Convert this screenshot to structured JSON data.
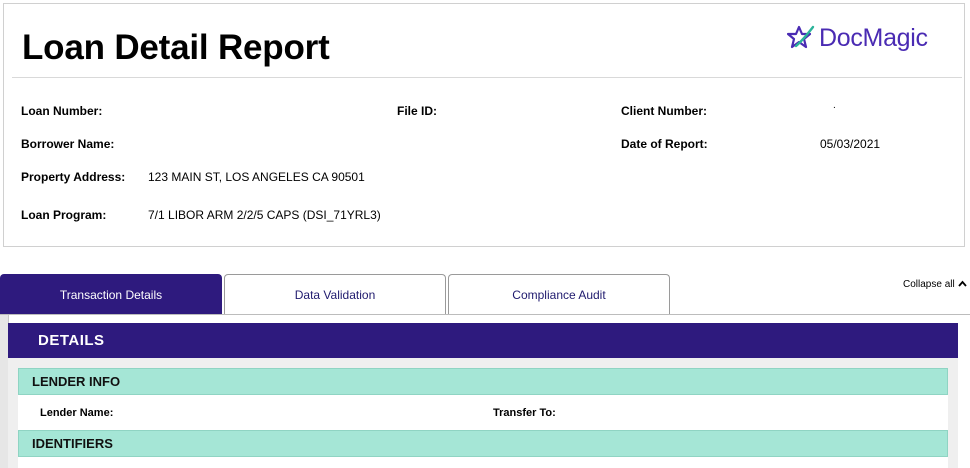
{
  "report": {
    "title": "Loan Detail Report",
    "logo_text": "DocMagic",
    "logo_icon": "star-swoosh-icon",
    "brand_color": "#4a2bb3"
  },
  "fields": {
    "loan_number": {
      "label": "Loan Number:",
      "value": ""
    },
    "file_id": {
      "label": "File ID:",
      "value": ""
    },
    "client_number": {
      "label": "Client Number:",
      "value": "."
    },
    "borrower_name": {
      "label": "Borrower Name:",
      "value": ""
    },
    "date_of_report": {
      "label": "Date of Report:",
      "value": "05/03/2021"
    },
    "property_address": {
      "label": "Property Address:",
      "value": "123 MAIN ST, LOS ANGELES CA 90501"
    },
    "loan_program": {
      "label": "Loan Program:",
      "value": "7/1 LIBOR ARM 2/2/5 CAPS (DSI_71YRL3)"
    }
  },
  "tabs": [
    {
      "label": "Transaction Details",
      "active": true
    },
    {
      "label": "Data Validation",
      "active": false
    },
    {
      "label": "Compliance Audit",
      "active": false
    }
  ],
  "collapse_all": {
    "label": "Collapse all",
    "icon": "chevron-up-icon"
  },
  "details": {
    "heading": "DETAILS",
    "lender_info": {
      "heading": "LENDER INFO",
      "lender_name_label": "Lender Name:",
      "transfer_to_label": "Transfer To:"
    },
    "identifiers": {
      "heading": "IDENTIFIERS"
    }
  },
  "colors": {
    "primary": "#2e1a7e",
    "section_bg": "#a5e6d6"
  }
}
